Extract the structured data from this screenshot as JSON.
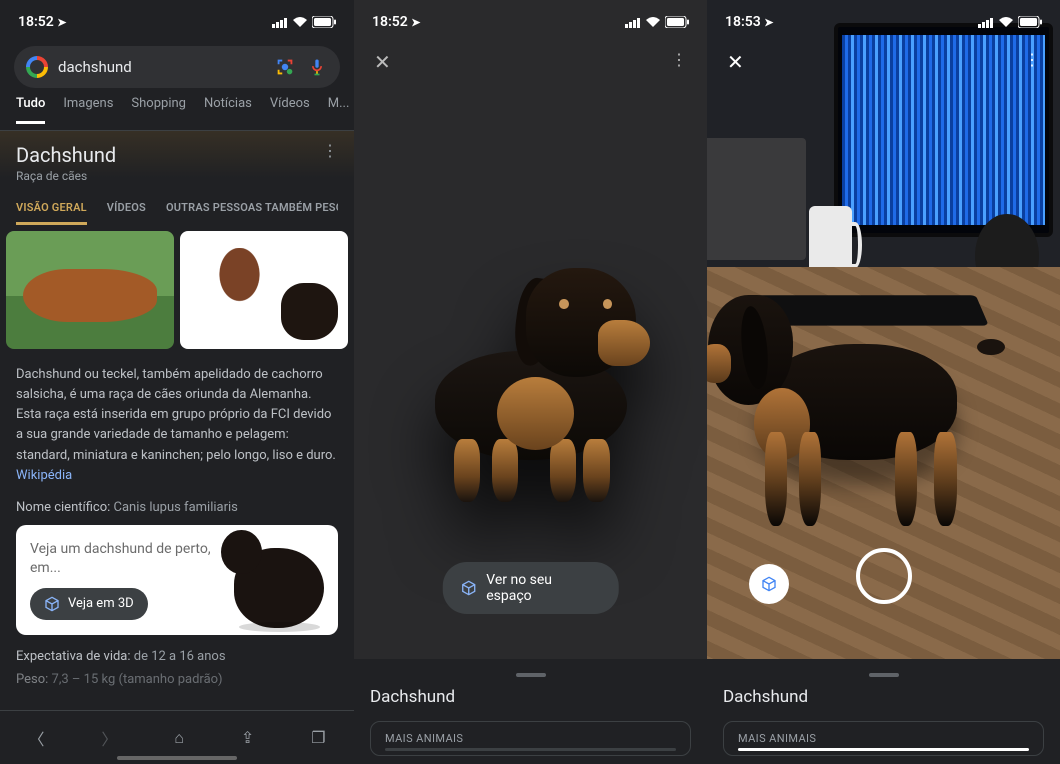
{
  "status": {
    "time1": "18:52",
    "time2": "18:52",
    "time3": "18:53",
    "location_glyph": "➤",
    "signal": "▮▮▮▯",
    "wifi": "✓",
    "batt": "▮▮"
  },
  "search": {
    "query": "dachshund"
  },
  "tabs": {
    "all": "Tudo",
    "images": "Imagens",
    "shopping": "Shopping",
    "news": "Notícias",
    "videos": "Vídeos",
    "more": "M..."
  },
  "kp": {
    "title": "Dachshund",
    "subtitle": "Raça de cães",
    "tabs": {
      "overview": "VISÃO GERAL",
      "videos": "VÍDEOS",
      "people": "OUTRAS PESSOAS TAMBÉM PESQU"
    }
  },
  "desc": {
    "text": "Dachshund ou teckel, também apelidado de cachorro salsicha, é uma raça de cães oriunda da Alemanha. Esta raça está inserida em grupo próprio da FCI devido a sua grande variedade de tamanho e pelagem: standard, miniatura e kaninchen; pelo longo, liso e duro. ",
    "source": "Wikipédia"
  },
  "facts": {
    "sciname_label": "Nome científico:",
    "sciname_val": " Canis lupus familiaris",
    "life_label": "Expectativa de vida:",
    "life_val": " de 12 a 16 anos",
    "weight_label": "Peso:",
    "weight_val": " 7,3 – 15 kg (tamanho padrão)"
  },
  "card3d": {
    "text": "Veja um dachshund de perto, em...",
    "btn": "Veja em 3D"
  },
  "panel2": {
    "ar_btn": "Ver no seu espaço",
    "sheet_title": "Dachshund",
    "more": "MAIS ANIMAIS"
  },
  "panel3": {
    "sheet_title": "Dachshund",
    "more": "MAIS ANIMAIS"
  }
}
